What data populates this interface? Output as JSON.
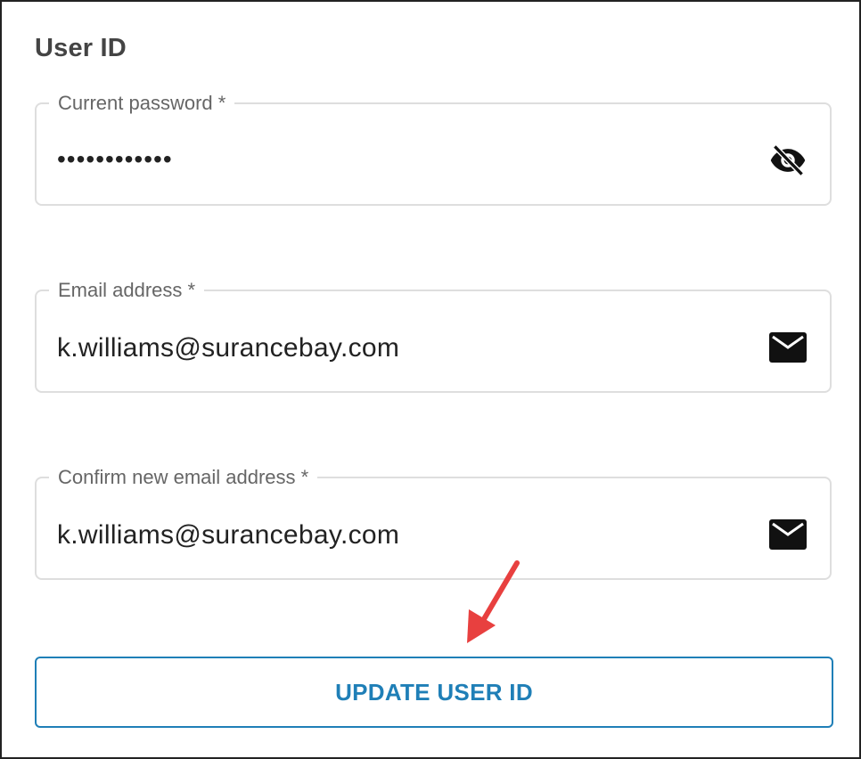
{
  "section_title": "User ID",
  "fields": {
    "current_password": {
      "label": "Current password *",
      "value": "••••••••••••",
      "icon": "eye-off-icon"
    },
    "email": {
      "label": "Email address *",
      "value": "k.williams@surancebay.com",
      "icon": "mail-icon"
    },
    "confirm_email": {
      "label": "Confirm new email address *",
      "value": "k.williams@surancebay.com",
      "icon": "mail-icon"
    }
  },
  "button": {
    "label": "UPDATE USER ID"
  },
  "colors": {
    "accent": "#1f7fb7",
    "annotation_arrow": "#e8403f",
    "field_border": "#dedede",
    "label_text": "#666666"
  }
}
